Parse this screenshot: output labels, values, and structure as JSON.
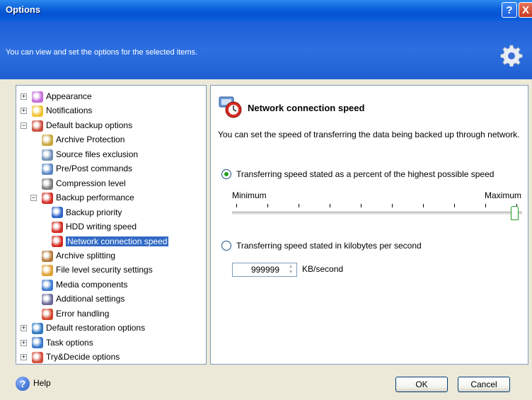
{
  "window": {
    "title": "Options",
    "help_glyph": "?",
    "close_glyph": "X"
  },
  "banner": {
    "description": "You can view and set the options for the selected items.",
    "icon": "gear-icon"
  },
  "tree": {
    "items": [
      {
        "label": "Appearance",
        "icon": "appearance-icon",
        "expander": "+"
      },
      {
        "label": "Notifications",
        "icon": "notifications-icon",
        "expander": "+"
      },
      {
        "label": "Default backup options",
        "icon": "backup-options-icon",
        "expander": "−"
      },
      {
        "label": "Archive Protection",
        "icon": "lock-icon"
      },
      {
        "label": "Source files exclusion",
        "icon": "filter-icon"
      },
      {
        "label": "Pre/Post commands",
        "icon": "commands-icon"
      },
      {
        "label": "Compression level",
        "icon": "compression-icon"
      },
      {
        "label": "Backup performance",
        "icon": "performance-icon",
        "expander": "−"
      },
      {
        "label": "Backup priority",
        "icon": "priority-icon"
      },
      {
        "label": "HDD writing speed",
        "icon": "hdd-speed-icon"
      },
      {
        "label": "Network connection speed",
        "icon": "network-speed-icon",
        "selected": true
      },
      {
        "label": "Archive splitting",
        "icon": "splitting-icon"
      },
      {
        "label": "File level security settings",
        "icon": "security-icon"
      },
      {
        "label": "Media components",
        "icon": "media-icon"
      },
      {
        "label": "Additional settings",
        "icon": "settings-icon"
      },
      {
        "label": "Error handling",
        "icon": "error-icon"
      },
      {
        "label": "Default restoration options",
        "icon": "restore-icon",
        "expander": "+"
      },
      {
        "label": "Task options",
        "icon": "task-icon",
        "expander": "+"
      },
      {
        "label": "Try&Decide options",
        "icon": "try-decide-icon",
        "expander": "+"
      }
    ]
  },
  "panel": {
    "title": "Network connection speed",
    "description": "You can set the speed of transferring the data being backed up through network.",
    "option_percent": "Transferring speed stated as a percent of the highest possible speed",
    "slider_min_label": "Minimum",
    "slider_max_label": "Maximum",
    "slider_value_percent": 100,
    "option_kb": "Transferring speed stated in kilobytes per second",
    "kb_value": "999999",
    "kb_unit": "KB/second",
    "selected_option": "percent"
  },
  "footer": {
    "help_label": "Help",
    "ok_label": "OK",
    "cancel_label": "Cancel"
  },
  "colors": {
    "title_blue": "#0554D3",
    "selection": "#316AC5",
    "radio_green": "#21A121"
  }
}
